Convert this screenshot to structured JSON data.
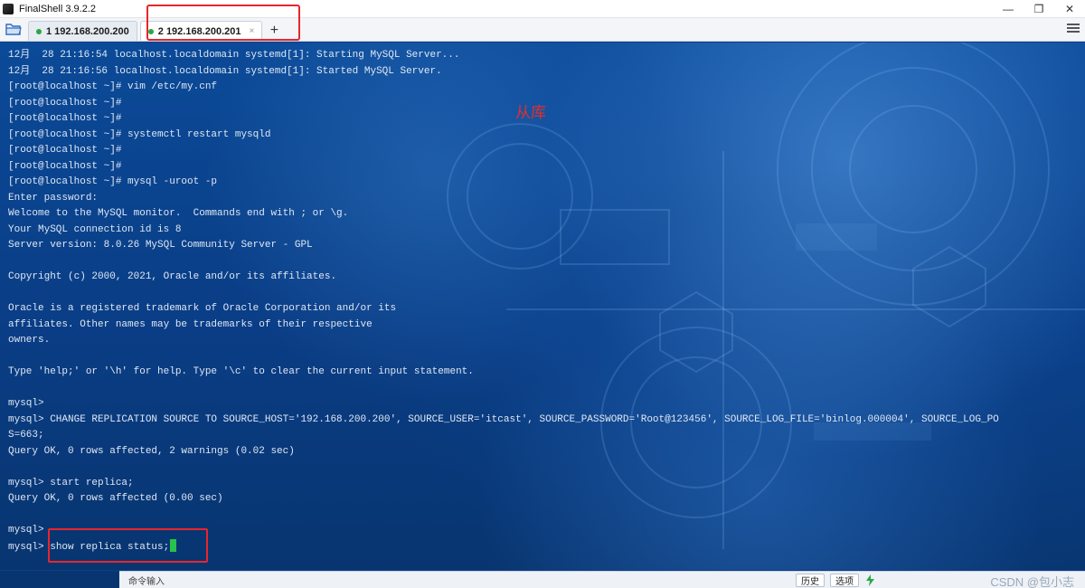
{
  "window": {
    "title": "FinalShell 3.9.2.2",
    "controls": {
      "minimize": "—",
      "maximize": "❐",
      "close": "✕"
    }
  },
  "tabs": [
    {
      "label": "1 192.168.200.200",
      "active": false
    },
    {
      "label": "2 192.168.200.201",
      "active": true
    }
  ],
  "add_tab_label": "+",
  "tab_close_glyph": "×",
  "annotation": "从库",
  "terminal": {
    "lines": [
      "12月  28 21:16:54 localhost.localdomain systemd[1]: Starting MySQL Server...",
      "12月  28 21:16:56 localhost.localdomain systemd[1]: Started MySQL Server.",
      "[root@localhost ~]# vim /etc/my.cnf",
      "[root@localhost ~]#",
      "[root@localhost ~]#",
      "[root@localhost ~]# systemctl restart mysqld",
      "[root@localhost ~]#",
      "[root@localhost ~]#",
      "[root@localhost ~]# mysql -uroot -p",
      "Enter password:",
      "Welcome to the MySQL monitor.  Commands end with ; or \\g.",
      "Your MySQL connection id is 8",
      "Server version: 8.0.26 MySQL Community Server - GPL",
      "",
      "Copyright (c) 2000, 2021, Oracle and/or its affiliates.",
      "",
      "Oracle is a registered trademark of Oracle Corporation and/or its",
      "affiliates. Other names may be trademarks of their respective",
      "owners.",
      "",
      "Type 'help;' or '\\h' for help. Type '\\c' to clear the current input statement.",
      "",
      "mysql>",
      "mysql> CHANGE REPLICATION SOURCE TO SOURCE_HOST='192.168.200.200', SOURCE_USER='itcast', SOURCE_PASSWORD='Root@123456', SOURCE_LOG_FILE='binlog.000004', SOURCE_LOG_PO",
      "S=663;",
      "Query OK, 0 rows affected, 2 warnings (0.02 sec)",
      "",
      "mysql> start replica;",
      "Query OK, 0 rows affected (0.00 sec)",
      "",
      "mysql>"
    ],
    "current_prompt": "mysql> ",
    "current_command": "show replica status;"
  },
  "command_bar": {
    "input_label": "命令输入",
    "history_button": "历史",
    "options_button": "选项"
  },
  "watermark": "CSDN @包小志",
  "colors": {
    "terminal_text": "#dfe8f4",
    "cursor": "#28c24a",
    "highlight_box": "#e8262b",
    "annotation": "#e0302e",
    "connected_dot": "#28a745"
  }
}
